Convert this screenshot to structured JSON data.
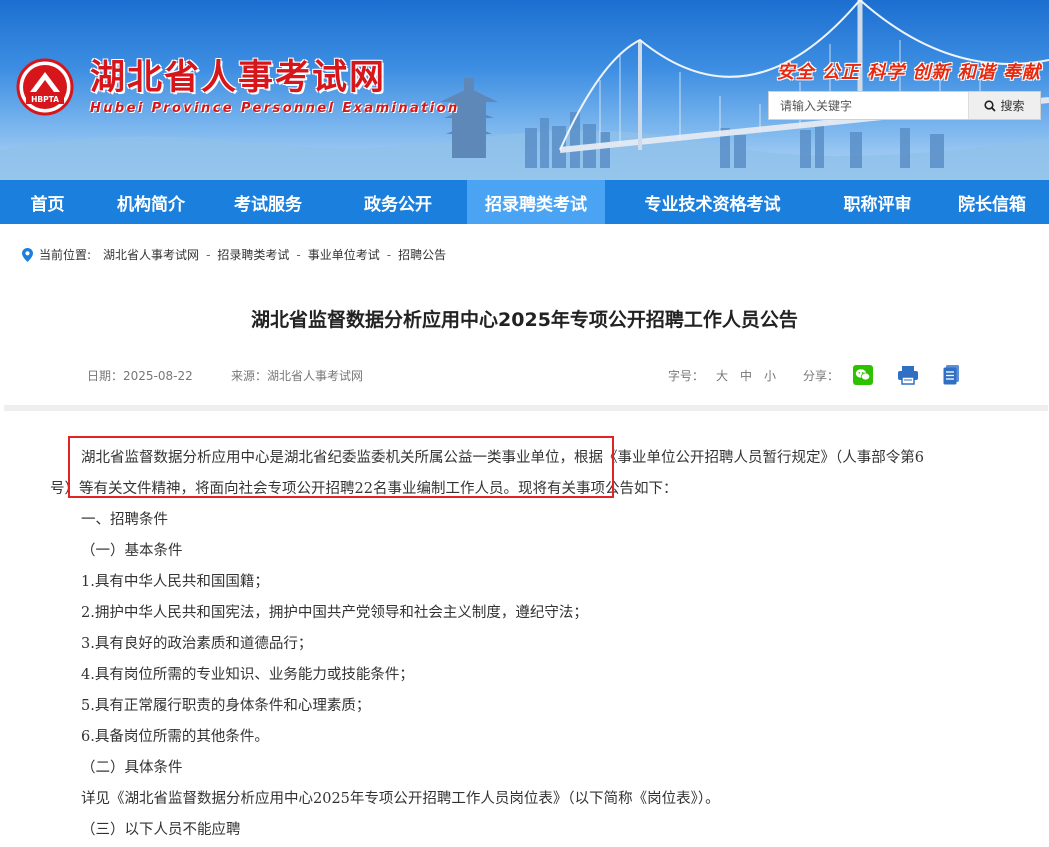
{
  "header": {
    "logo_text": "HBPTA",
    "site_title": "湖北省人事考试网",
    "site_subtitle": "Hubei Province Personnel Examination",
    "slogan": "安全 公正 科学 创新 和谐 奉献",
    "search": {
      "placeholder": "请输入关键字",
      "button_label": "搜索"
    }
  },
  "nav": {
    "items": [
      {
        "label": "首页",
        "active": false
      },
      {
        "label": "机构简介",
        "active": false
      },
      {
        "label": "考试服务",
        "active": false
      },
      {
        "label": "政务公开",
        "active": false
      },
      {
        "label": "招录聘类考试",
        "active": true
      },
      {
        "label": "专业技术资格考试",
        "active": false
      },
      {
        "label": "职称评审",
        "active": false
      },
      {
        "label": "院长信箱",
        "active": false
      }
    ]
  },
  "breadcrumb": {
    "label": "当前位置:",
    "items": [
      "湖北省人事考试网",
      "招录聘类考试",
      "事业单位考试",
      "招聘公告"
    ],
    "separator": "-"
  },
  "article": {
    "title": "湖北省监督数据分析应用中心2025年专项公开招聘工作人员公告",
    "date": "日期：2025-08-22",
    "source": "来源：湖北省人事考试网",
    "font_label": "字号：",
    "font_sizes": [
      "大",
      "中",
      "小"
    ],
    "share_label": "分享：",
    "paragraphs": [
      "湖北省监督数据分析应用中心是湖北省纪委监委机关所属公益一类事业单位，根据《事业单位公开招聘人员暂行规定》（人事部令第6",
      "号）等有关文件精神，将面向社会专项公开招聘22名事业编制工作人员。现将有关事项公告如下：",
      "一、招聘条件",
      "（一）基本条件",
      "1.具有中华人民共和国国籍；",
      "2.拥护中华人民共和国宪法，拥护中国共产党领导和社会主义制度，遵纪守法；",
      "3.具有良好的政治素质和道德品行；",
      "4.具有岗位所需的专业知识、业务能力或技能条件；",
      "5.具有正常履行职责的身体条件和心理素质；",
      "6.具备岗位所需的其他条件。",
      "（二）具体条件",
      "详见《湖北省监督数据分析应用中心2025年专项公开招聘工作人员岗位表》（以下简称《岗位表》）。",
      "（三）以下人员不能应聘"
    ]
  },
  "colors": {
    "nav_bg": "#1b7fde",
    "nav_active": "#4aa3f3",
    "title_red": "#d7161b",
    "highlight": "#e02424",
    "wechat_green": "#2dc100",
    "print_blue": "#2f6fc4"
  },
  "icons": [
    "location-pin-icon",
    "search-icon",
    "wechat-icon",
    "print-icon",
    "bookmark-icon"
  ]
}
